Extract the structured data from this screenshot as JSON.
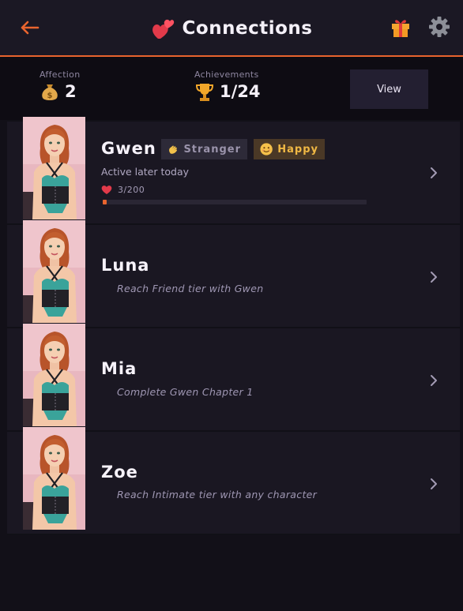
{
  "header": {
    "title": "Connections",
    "back_icon": "arrow-left-icon",
    "title_icon": "hearts-icon",
    "gift_icon": "gift-icon",
    "settings_icon": "gear-icon"
  },
  "stats": {
    "affection": {
      "label": "Affection",
      "value": "2",
      "icon": "money-bag-icon"
    },
    "achievements": {
      "label": "Achievements",
      "value": "1/24",
      "icon": "trophy-icon"
    },
    "view_button": "View"
  },
  "characters": [
    {
      "name": "Gwen",
      "tier_badge": "Stranger",
      "tier_icon": "waving-hand-icon",
      "mood_badge": "Happy",
      "mood_icon": "smiling-face-icon",
      "status": "Active later today",
      "affection_text": "3/200",
      "affection_value": 3,
      "affection_max": 200
    },
    {
      "name": "Luna",
      "unlock_hint": "Reach Friend tier with Gwen"
    },
    {
      "name": "Mia",
      "unlock_hint": "Complete Gwen Chapter 1"
    },
    {
      "name": "Zoe",
      "unlock_hint": "Reach Intimate tier with any character"
    }
  ],
  "colors": {
    "accent": "#e8642e",
    "background": "#121018",
    "card": "#1a1722",
    "mood": "#f0b844"
  }
}
